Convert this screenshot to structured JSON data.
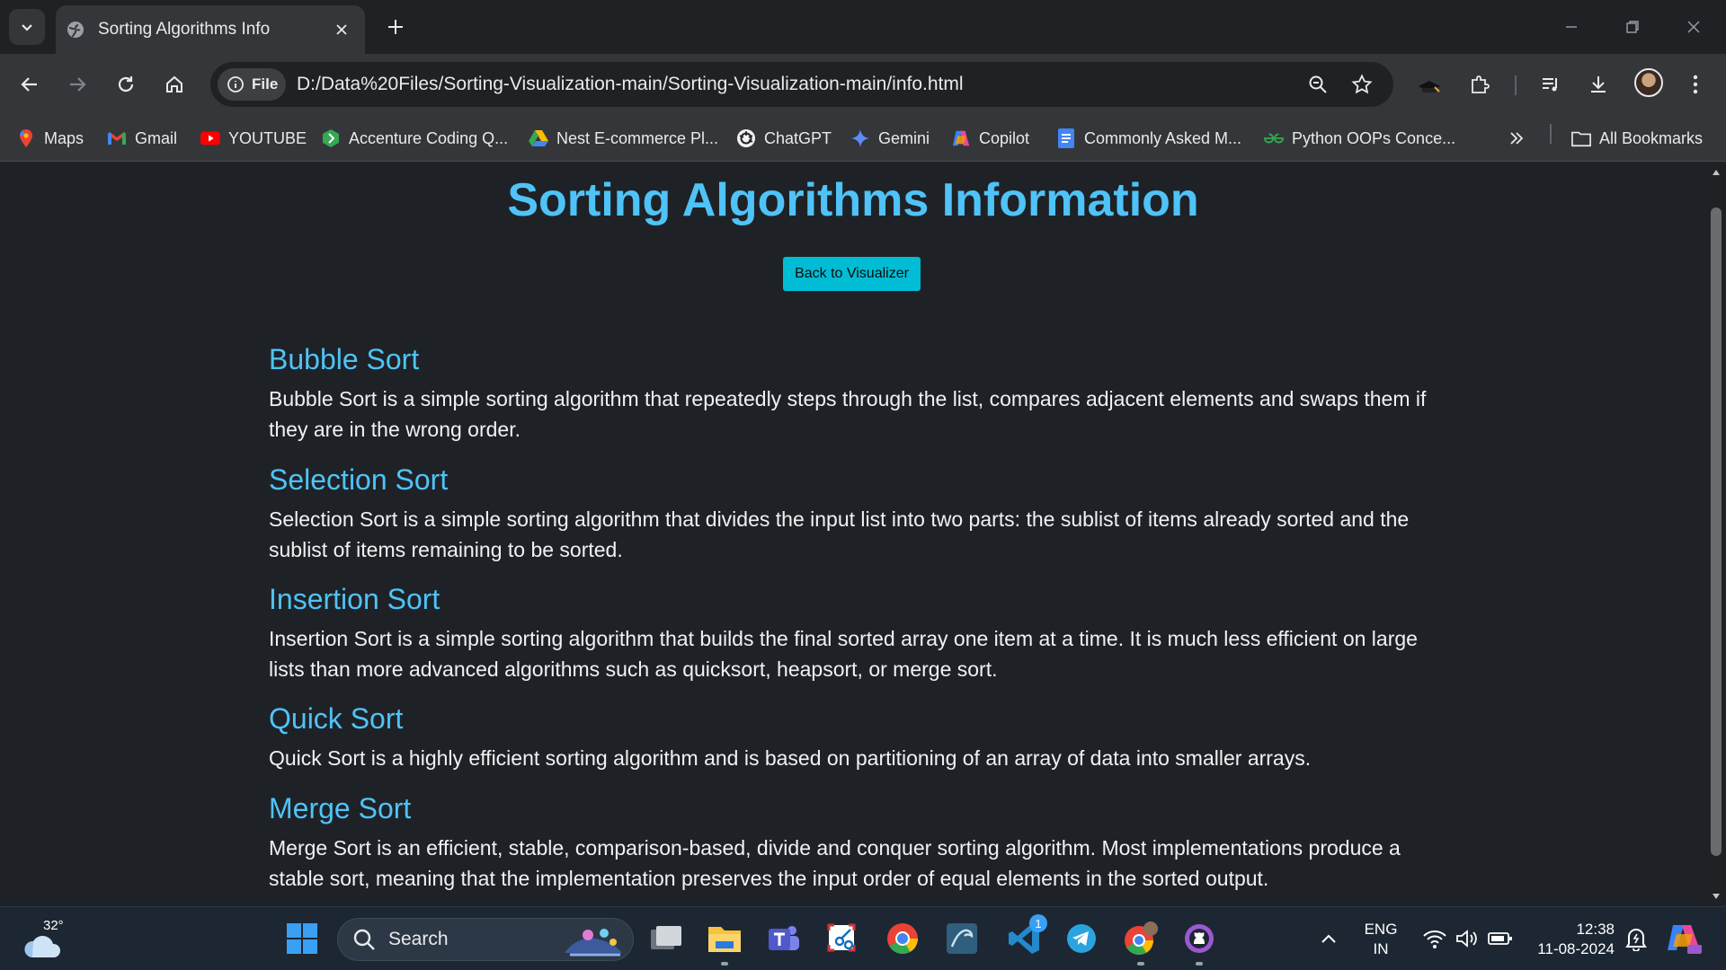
{
  "browser": {
    "tab_title": "Sorting Algorithms Info",
    "chip_label": "File",
    "url": "D:/Data%20Files/Sorting-Visualization-main/Sorting-Visualization-main/info.html",
    "bookmarks": [
      {
        "label": "Maps",
        "icon": "maps-icon"
      },
      {
        "label": "Gmail",
        "icon": "gmail-icon"
      },
      {
        "label": "YOUTUBE",
        "icon": "youtube-icon"
      },
      {
        "label": "Accenture Coding Q...",
        "icon": "accenture-icon"
      },
      {
        "label": "Nest E-commerce Pl...",
        "icon": "drive-icon"
      },
      {
        "label": "ChatGPT",
        "icon": "chatgpt-icon"
      },
      {
        "label": "Gemini",
        "icon": "gemini-icon"
      },
      {
        "label": "Copilot",
        "icon": "copilot-icon"
      },
      {
        "label": "Commonly Asked M...",
        "icon": "docs-icon"
      },
      {
        "label": "Python OOPs Conce...",
        "icon": "gfg-icon"
      }
    ],
    "all_bookmarks_label": "All Bookmarks"
  },
  "page": {
    "title": "Sorting Algorithms Information",
    "back_button": "Back to Visualizer",
    "algorithms": [
      {
        "name": "Bubble Sort",
        "description": "Bubble Sort is a simple sorting algorithm that repeatedly steps through the list, compares adjacent elements and swaps them if they are in the wrong order."
      },
      {
        "name": "Selection Sort",
        "description": "Selection Sort is a simple sorting algorithm that divides the input list into two parts: the sublist of items already sorted and the sublist of items remaining to be sorted."
      },
      {
        "name": "Insertion Sort",
        "description": "Insertion Sort is a simple sorting algorithm that builds the final sorted array one item at a time. It is much less efficient on large lists than more advanced algorithms such as quicksort, heapsort, or merge sort."
      },
      {
        "name": "Quick Sort",
        "description": "Quick Sort is a highly efficient sorting algorithm and is based on partitioning of an array of data into smaller arrays."
      },
      {
        "name": "Merge Sort",
        "description": "Merge Sort is an efficient, stable, comparison-based, divide and conquer sorting algorithm. Most implementations produce a stable sort, meaning that the implementation preserves the input order of equal elements in the sorted output."
      }
    ]
  },
  "taskbar": {
    "weather_temp": "32°",
    "search_label": "Search",
    "teams_badge": "1",
    "lang_line1": "ENG",
    "lang_line2": "IN",
    "time": "12:38",
    "date": "11-08-2024"
  },
  "colors": {
    "heading": "#4fc3f7",
    "button": "#00bcd4",
    "page_bg": "#1e2227"
  }
}
